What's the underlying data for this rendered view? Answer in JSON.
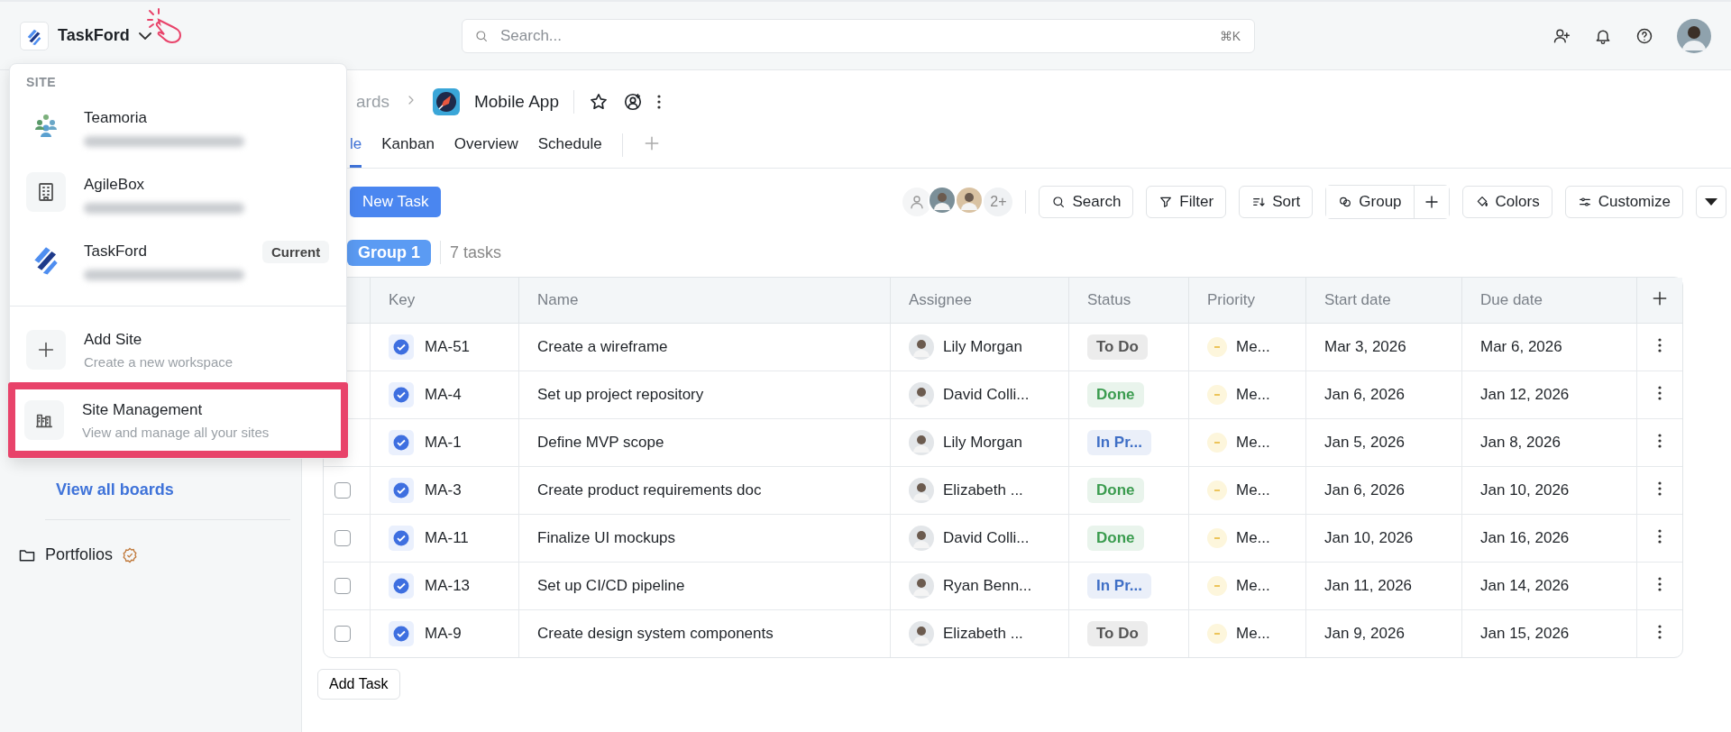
{
  "topbar": {
    "brand": "TaskFord",
    "search": {
      "placeholder": "Search...",
      "shortcut": "⌘K"
    }
  },
  "site_menu": {
    "heading": "SITE",
    "sites": [
      {
        "name": "Teamoria"
      },
      {
        "name": "AgileBox"
      },
      {
        "name": "TaskFord",
        "badge": "Current"
      }
    ],
    "actions": [
      {
        "title": "Add Site",
        "subtitle": "Create a new workspace",
        "highlighted": false
      },
      {
        "title": "Site Management",
        "subtitle": "View and manage all your sites",
        "highlighted": true
      }
    ]
  },
  "sidebar": {
    "link": "View all boards",
    "items": [
      {
        "label": "Portfolios"
      }
    ]
  },
  "breadcrumb": {
    "parent": "ards",
    "title": "Mobile App"
  },
  "tabs": [
    {
      "label": "le",
      "selected": true
    },
    {
      "label": "Kanban",
      "selected": false
    },
    {
      "label": "Overview",
      "selected": false
    },
    {
      "label": "Schedule",
      "selected": false
    }
  ],
  "toolbar": {
    "new_task": "New Task",
    "more_members": "2+",
    "buttons": [
      {
        "label": "Search"
      },
      {
        "label": "Filter"
      },
      {
        "label": "Sort"
      },
      {
        "label": "Group"
      },
      {
        "label": "Colors"
      },
      {
        "label": "Customize"
      }
    ]
  },
  "group": {
    "label": "Group 1",
    "count": "7 tasks"
  },
  "table": {
    "columns": [
      "Key",
      "Name",
      "Assignee",
      "Status",
      "Priority",
      "Start date",
      "Due date"
    ],
    "rows": [
      {
        "key": "MA-51",
        "name": "Create a wireframe",
        "assignee": "Lily Morgan",
        "status": "To Do",
        "color": "#555555",
        "priority": "Me...",
        "start": "Mar 3, 2026",
        "due": "Mar 6, 2026"
      },
      {
        "key": "MA-4",
        "name": "Set up project repository",
        "assignee": "David Colli...",
        "status": "Done",
        "color": "#3b9c4f",
        "priority": "Me...",
        "start": "Jan 6, 2026",
        "due": "Jan 12, 2026"
      },
      {
        "key": "MA-1",
        "name": "Define MVP scope",
        "assignee": "Lily Morgan",
        "status": "In Pr...",
        "color": "#3f6fc6",
        "priority": "Me...",
        "start": "Jan 5, 2026",
        "due": "Jan 8, 2026"
      },
      {
        "checked": false,
        "key": "MA-3",
        "name": "Create product requirements doc",
        "assignee": "Elizabeth ...",
        "status": "Done",
        "color": "#3b9c4f",
        "priority": "Me...",
        "start": "Jan 6, 2026",
        "due": "Jan 10, 2026"
      },
      {
        "checked": false,
        "key": "MA-11",
        "name": "Finalize UI mockups",
        "assignee": "David Colli...",
        "status": "Done",
        "color": "#3b9c4f",
        "priority": "Me...",
        "start": "Jan 10, 2026",
        "due": "Jan 16, 2026"
      },
      {
        "checked": false,
        "key": "MA-13",
        "name": "Set up CI/CD pipeline",
        "assignee": "Ryan Benn...",
        "status": "In Pr...",
        "color": "#3f6fc6",
        "priority": "Me...",
        "start": "Jan 11, 2026",
        "due": "Jan 14, 2026"
      },
      {
        "checked": false,
        "key": "MA-9",
        "name": "Create design system components",
        "assignee": "Elizabeth ...",
        "status": "To Do",
        "color": "#555555",
        "priority": "Me...",
        "start": "Jan 9, 2026",
        "due": "Jan 15, 2026"
      }
    ]
  },
  "add_task": "Add Task"
}
